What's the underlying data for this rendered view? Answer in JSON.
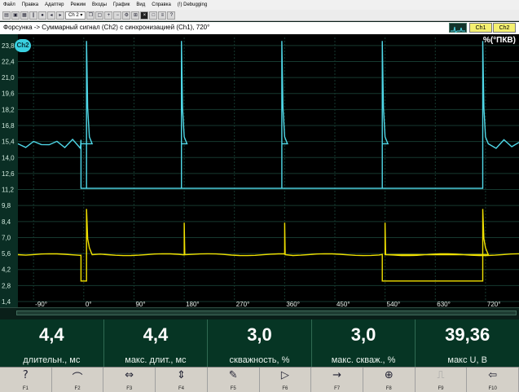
{
  "menu": {
    "items": [
      "Файл",
      "Правка",
      "Адаптер",
      "Режим",
      "Входы",
      "График",
      "Вид",
      "Справка",
      "(!) Debugging"
    ]
  },
  "toolbar": {
    "channel_combo": "Ch 2",
    "channel_options": [
      "Ch 2"
    ]
  },
  "window": {
    "title": "Форсунка -> Суммарный сигнал (Ch2) с синхронизацией (Ch1), 720°",
    "ch1_label": "Ch1",
    "ch2_label": "Ch2",
    "unit": "%(°ПКВ)"
  },
  "colors": {
    "ch1": "#f0e000",
    "ch2": "#4fd8e8",
    "plot_bg": "#000000",
    "grid": "#16392f",
    "axis_strip": "#0a2e24",
    "ch_button_active": "#f4f070"
  },
  "plot": {
    "active_channel_badge": "Ch2",
    "y_ticks": [
      "23,8",
      "22,4",
      "21,0",
      "19,6",
      "18,2",
      "16,8",
      "15,4",
      "14,0",
      "12,6",
      "11,2",
      "9,8",
      "8,4",
      "7,0",
      "5,6",
      "4,2",
      "2,8",
      "1,4"
    ],
    "x_ticks": [
      "-90°",
      "0°",
      "90°",
      "180°",
      "270°",
      "360°",
      "450°",
      "540°",
      "630°",
      "720°"
    ]
  },
  "readouts": [
    {
      "value": "4,4",
      "label": "длительн., мс"
    },
    {
      "value": "4,4",
      "label": "макс. длит., мс"
    },
    {
      "value": "3,0",
      "label": "скважность, %"
    },
    {
      "value": "3,0",
      "label": "макс. скваж., %"
    },
    {
      "value": "39,36",
      "label": "макс U, В"
    }
  ],
  "fkeys": [
    {
      "name": "F1",
      "icon": "help-icon",
      "glyph": "?"
    },
    {
      "name": "F2",
      "icon": "trace-icon",
      "glyph": "⌒"
    },
    {
      "name": "F3",
      "icon": "x-zoom-icon",
      "glyph": "⇔"
    },
    {
      "name": "F4",
      "icon": "y-zoom-icon",
      "glyph": "⇕"
    },
    {
      "name": "F5",
      "icon": "brush-icon",
      "glyph": "✎"
    },
    {
      "name": "F6",
      "icon": "play-icon",
      "glyph": "▷"
    },
    {
      "name": "F7",
      "icon": "arrow-right-icon",
      "glyph": "→"
    },
    {
      "name": "F8",
      "icon": "crosshair-icon",
      "glyph": "⊕"
    },
    {
      "name": "F9",
      "icon": "sync-icon",
      "glyph": "⎍"
    },
    {
      "name": "F10",
      "icon": "exit-icon",
      "glyph": "⇦"
    }
  ],
  "chart_data": {
    "type": "line",
    "title": "Форсунка -> Суммарный сигнал (Ch2) с синхронизацией (Ch1), 720°",
    "xlabel": "",
    "ylabel": "%(°ПКВ)",
    "x_unit": "°",
    "xlim": [
      -118,
      780
    ],
    "ylim": [
      1.4,
      24.5
    ],
    "grid": true,
    "series": [
      {
        "name": "Ch2",
        "color": "#4fd8e8",
        "baseline": 15.2,
        "low_level": 11.3,
        "spike_peak": 24.2,
        "pulses_deg": [
          [
            -5,
            5
          ],
          [
            -5,
            175
          ],
          [
            175,
            355
          ],
          [
            355,
            535
          ],
          [
            535,
            715
          ]
        ]
      },
      {
        "name": "Ch1",
        "color": "#f0e000",
        "baseline": 5.5,
        "low_level": 3.2,
        "spike_peak": 9.5,
        "sync_pulses_deg": [
          [
            -5,
            5
          ],
          [
            535,
            715
          ]
        ],
        "markers_deg": [
          180,
          360,
          540
        ]
      }
    ]
  }
}
